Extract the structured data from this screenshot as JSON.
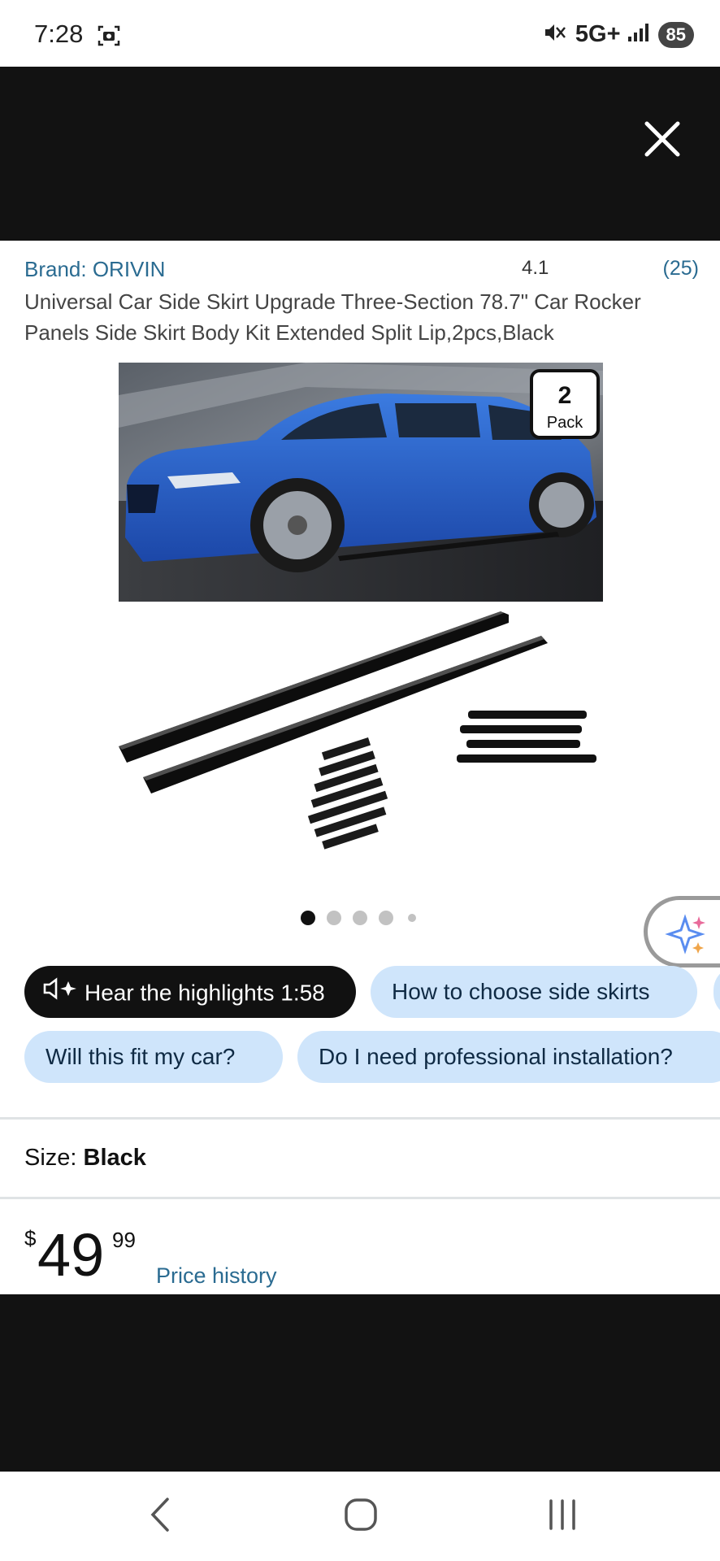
{
  "status_bar": {
    "time": "7:28",
    "network": "5G+",
    "battery": "85"
  },
  "product": {
    "brand": "Brand: ORIVIN",
    "rating": "4.1",
    "review_count": "(25)",
    "title": "Universal Car Side Skirt Upgrade Three-Section 78.7\" Car Rocker Panels Side Skirt Body Kit Extended Split Lip,2pcs,Black",
    "image_badge_number": "2",
    "image_badge_label": "Pack"
  },
  "carousel": {
    "total": 5,
    "active_index": 0
  },
  "chips": {
    "hear_highlights": "Hear the highlights 1:58",
    "how_to_choose": "How to choose side skirts",
    "will_fit": "Will this fit my car?",
    "professional_install": "Do I need professional installation?"
  },
  "size": {
    "label": "Size:",
    "value": "Black"
  },
  "price": {
    "currency": "$",
    "whole": "49",
    "fraction": "99",
    "history_link": "Price history"
  },
  "colors": {
    "link": "#2a6b91",
    "chip_light": "#cfe5fb",
    "overlay": "#121212"
  }
}
